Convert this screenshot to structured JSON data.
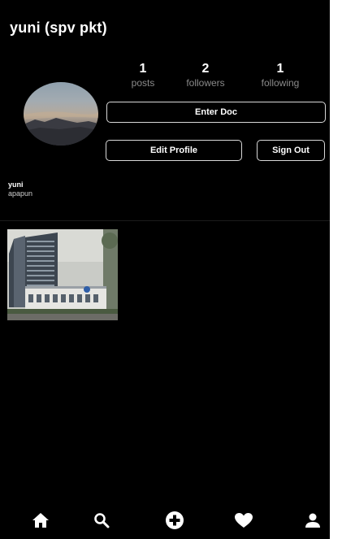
{
  "header": {
    "title": "yuni (spv pkt)"
  },
  "profile": {
    "stats": [
      {
        "count": "1",
        "label": "posts"
      },
      {
        "count": "2",
        "label": "followers"
      },
      {
        "count": "1",
        "label": "following"
      }
    ],
    "buttons": {
      "enter_doc": "Enter Doc",
      "edit_profile": "Edit Profile",
      "sign_out": "Sign Out"
    },
    "name": "yuni",
    "bio": "apapun"
  },
  "posts": [
    {
      "image": "office-building-photo"
    }
  ],
  "bottom_nav": [
    {
      "icon": "home-icon"
    },
    {
      "icon": "search-icon"
    },
    {
      "icon": "add-post-icon"
    },
    {
      "icon": "heart-icon"
    },
    {
      "icon": "profile-icon"
    }
  ],
  "colors": {
    "background": "#000000",
    "text": "#ffffff",
    "muted_text": "#8a8a8a",
    "button_border": "#d8d8d8"
  }
}
